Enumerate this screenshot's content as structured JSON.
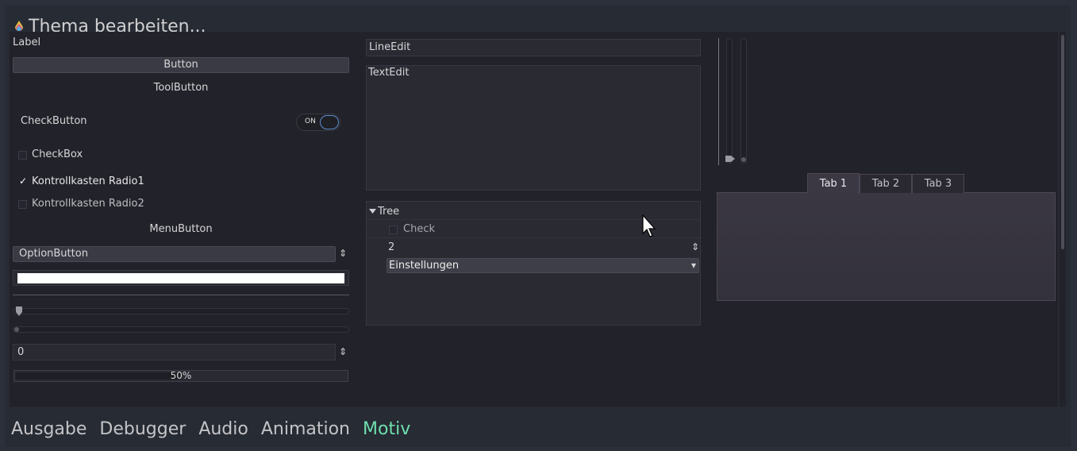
{
  "window": {
    "title": "Thema bearbeiten..."
  },
  "left": {
    "label": "Label",
    "button": "Button",
    "tool_button": "ToolButton",
    "check_button": "CheckButton",
    "switch_on": "ON",
    "checkbox": "CheckBox",
    "radio1": "Kontrollkasten Radio1",
    "radio1_mark": "✓",
    "radio2": "Kontrollkasten Radio2",
    "menu_button": "MenuButton",
    "option_button": "OptionButton",
    "option_arrows": "⇕",
    "spin_value": "0",
    "spin_arrows": "⇕",
    "progress_text": "50%",
    "progress_value": 0.5
  },
  "middle": {
    "line_edit": "LineEdit",
    "text_edit": "TextEdit",
    "tree": {
      "root": "Tree",
      "check": "Check",
      "number": "2",
      "number_arrows": "⇕",
      "settings": "Einstellungen",
      "settings_arrow": "▾"
    }
  },
  "right": {
    "tabs": [
      "Tab 1",
      "Tab 2",
      "Tab 3"
    ],
    "active_tab": 0
  },
  "bottom_bar": {
    "items": [
      "Ausgabe",
      "Debugger",
      "Audio",
      "Animation",
      "Motiv"
    ],
    "active": "Motiv"
  },
  "colors": {
    "accent": "#6ee0ae",
    "switch_border": "#5b8ec9",
    "background": "#22222a"
  }
}
